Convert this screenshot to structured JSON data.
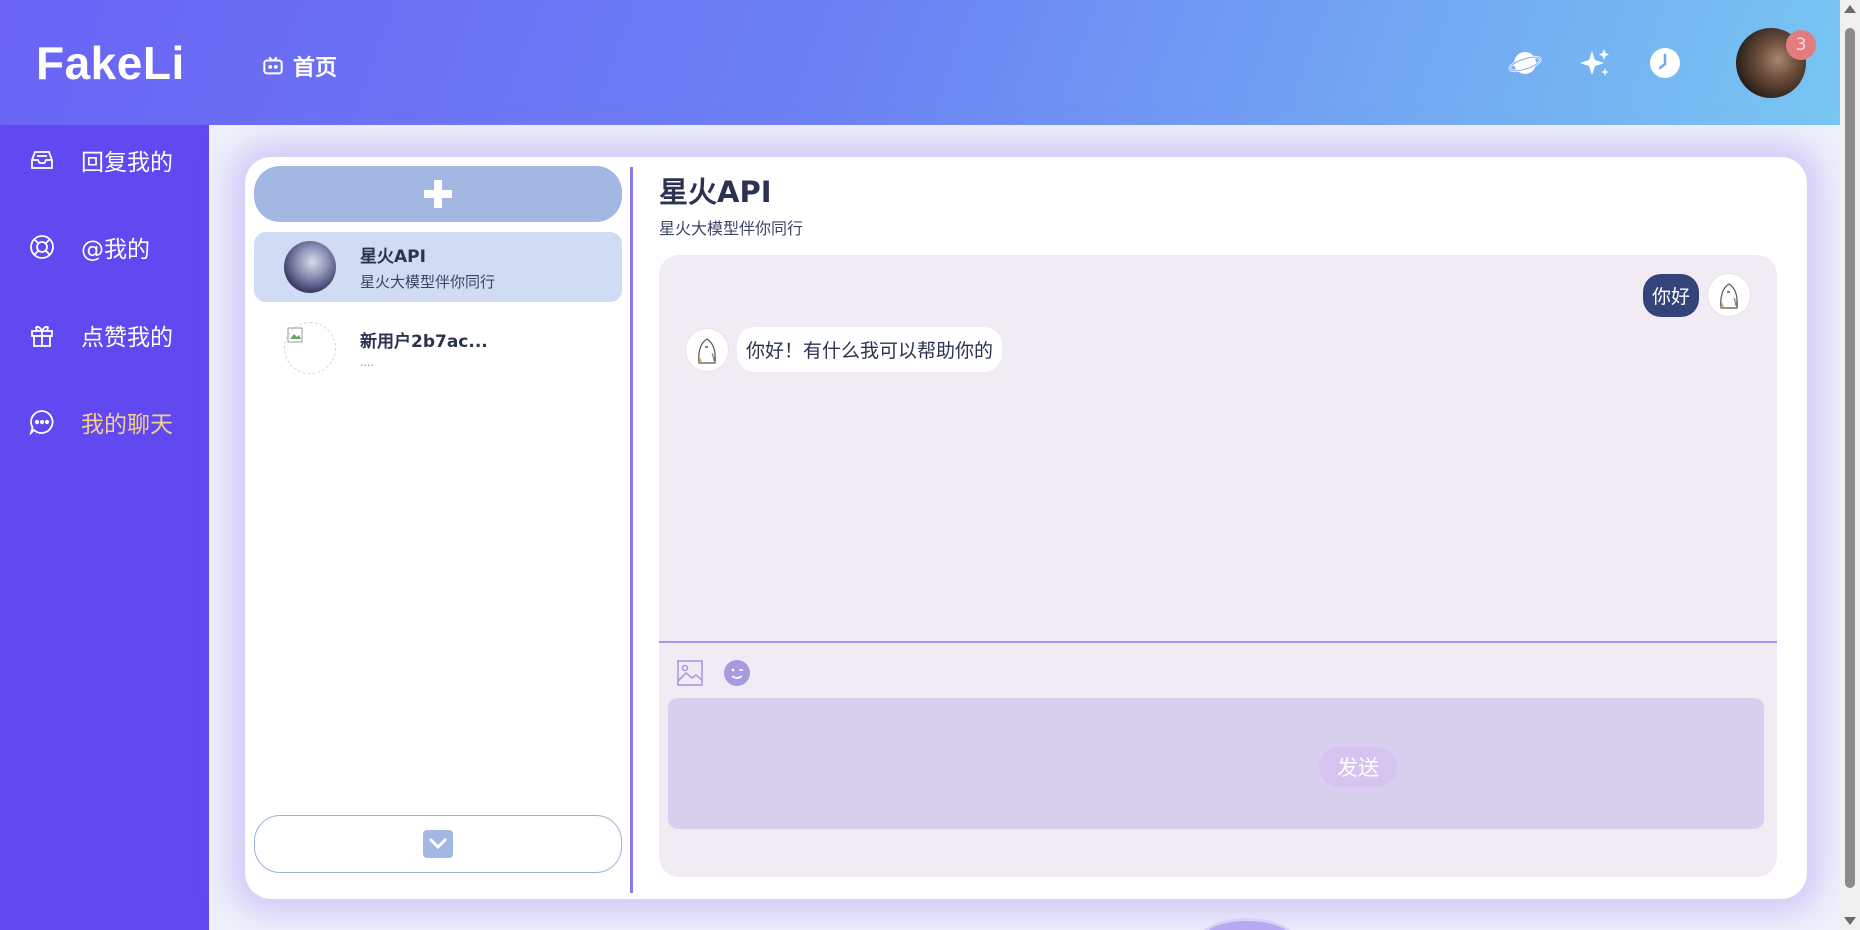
{
  "header": {
    "logo": "FakeLi",
    "home_label": "首页",
    "icons": [
      "planet-icon",
      "sparkle-icon",
      "clock-icon"
    ],
    "notification_count": "3"
  },
  "sidebar": {
    "items": [
      {
        "label": "回复我的",
        "icon": "inbox-icon"
      },
      {
        "label": "@我的",
        "icon": "at-icon"
      },
      {
        "label": "点赞我的",
        "icon": "gift-icon"
      },
      {
        "label": "我的聊天",
        "icon": "chat-bubble-icon",
        "active": true
      }
    ]
  },
  "conversations": [
    {
      "title": "星火API",
      "subtitle": "星火大模型伴你同行",
      "active": true
    },
    {
      "title": "新用户2b7ac...",
      "subtitle": "....",
      "active": false
    }
  ],
  "chat": {
    "title": "星火API",
    "subtitle": "星火大模型伴你同行",
    "messages": [
      {
        "from": "me",
        "text": "你好"
      },
      {
        "from": "bot",
        "text": "你好！有什么我可以帮助你的"
      }
    ],
    "input_placeholder": "",
    "send_label": "发送"
  },
  "colors": {
    "sidebar_bg": "#6049f0",
    "active_sidebar_text": "#f6cf8b",
    "my_bubble": "#34447a",
    "chat_panel": "#f1ebf4",
    "input_bg": "#d8cfef"
  }
}
